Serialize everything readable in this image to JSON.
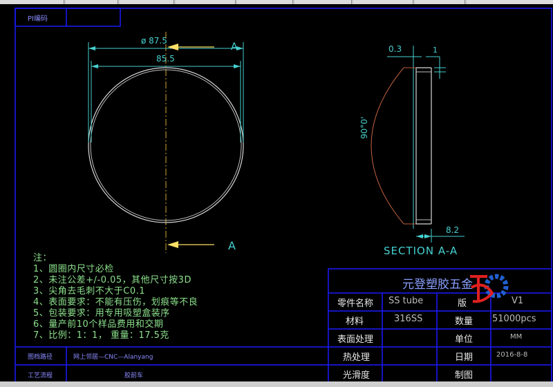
{
  "colors": {
    "background": "#000000",
    "border": "#1a1aff",
    "dim": "#47d1d1",
    "outline": "#d9d9d9",
    "text_notes": "#8ce08c",
    "centerline": "#d4a72c",
    "arc": "#c06040",
    "arrow": "#ffe066",
    "logo_red": "#e02020",
    "logo_blue": "#2060d0"
  },
  "header": {
    "pi_label": "PI编码"
  },
  "front_view": {
    "dim_outer": "ø 87.5",
    "dim_inner": "85.5",
    "section_mark_top": "A",
    "section_mark_bottom": "A"
  },
  "section_view": {
    "dim_top_left": "0.3",
    "dim_top_right": "1",
    "dim_angle": "90°0'",
    "dim_bottom": "8.2",
    "title": "SECTION A-A"
  },
  "notes": {
    "heading": "注：",
    "items": [
      "1、圆圈内尺寸必检",
      "2、未注公差+/-0.05，其他尺寸按3D",
      "3、尖角去毛刺不大于C0.1",
      "4、表面要求：不能有压伤，划痕等不良",
      "5、包装要求：用专用吸塑盒装序",
      "6、量产前10个样品费用和交期",
      "7、比例：1：1，   重量：17.5克"
    ]
  },
  "title_block": {
    "company": "元登塑胶五金",
    "rows": [
      {
        "label": "零件名称",
        "value": "SS tube",
        "label2": "版",
        "value2": "V1"
      },
      {
        "label": "材料",
        "value": "316SS",
        "label2": "数量",
        "value2": "51000pcs"
      },
      {
        "label": "表面处理",
        "value": "",
        "label2": "单位",
        "value2": "MM"
      },
      {
        "label": "热处理",
        "value": "",
        "label2": "日期",
        "value2": "2016-8-8"
      },
      {
        "label": "光滑度",
        "value": "",
        "label2": "制图",
        "value2": ""
      }
    ]
  },
  "footer": {
    "row1_label": "图档路径",
    "row1_value": "网上邻居—CNC—Alanyang",
    "row2_label": "工艺流程",
    "row2_value": "胶前车"
  }
}
